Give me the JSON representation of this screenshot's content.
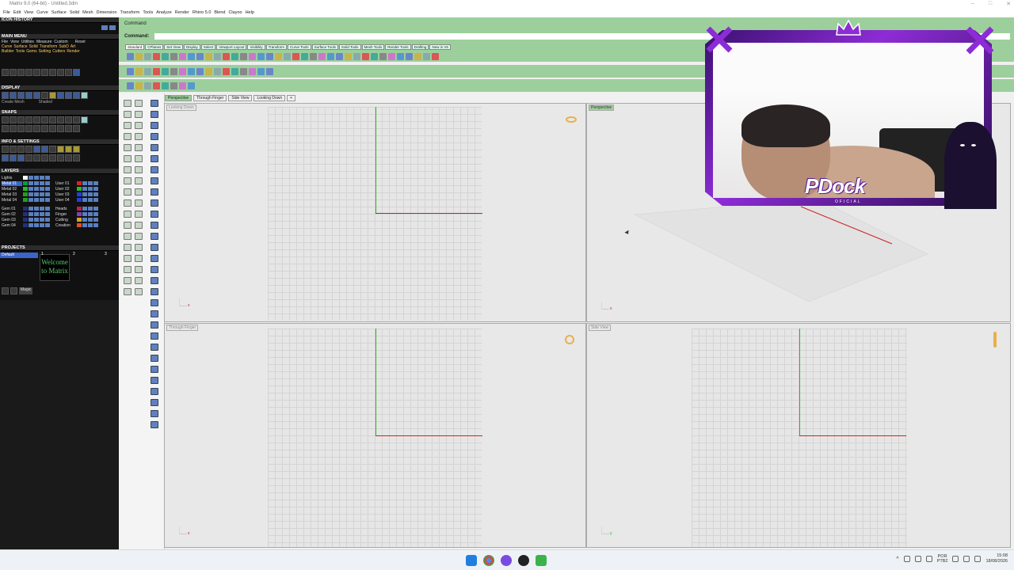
{
  "window": {
    "title": "Matrix 9.0 (64-bit) - Untitled.3dm"
  },
  "menu": [
    "File",
    "Edit",
    "View",
    "Curve",
    "Surface",
    "Solid",
    "Mesh",
    "Dimension",
    "Transform",
    "Tools",
    "Analyze",
    "Render",
    "Rhino 5.0",
    "Blend",
    "Clayoo",
    "Help"
  ],
  "left_panel": {
    "icon_history": "ICON HISTORY",
    "main_menu": "MAIN MENU",
    "main_menu_row1": [
      "File",
      "View",
      "Utilities",
      "Measure",
      "Custom",
      "Reset"
    ],
    "main_menu_row2": [
      "Curve",
      "Surface",
      "Solid",
      "Transform",
      "SubD",
      "Art"
    ],
    "main_menu_row3": [
      "Builder",
      "Tools",
      "Gems",
      "Setting",
      "Cutters",
      "Render"
    ],
    "display": "DISPLAY",
    "display_sub": [
      "Create Mesh",
      "Shaded"
    ],
    "snaps": "SNAPS",
    "info_settings": "INFO & SETTINGS",
    "layers": "LAYERS",
    "layers_list": [
      {
        "left": "Lights",
        "right": "",
        "left_color": "#ffffff",
        "right_color": ""
      },
      {
        "left": "Metal 01",
        "right": "User 01",
        "left_color": "#00a040",
        "right_color": "#e02020",
        "selected": true
      },
      {
        "left": "Metal 02",
        "right": "User 02",
        "left_color": "#20c020",
        "right_color": "#20c020"
      },
      {
        "left": "Metal 03",
        "right": "User 03",
        "left_color": "#20a020",
        "right_color": "#2040e0"
      },
      {
        "left": "Metal 04",
        "right": "User 04",
        "left_color": "#20a020",
        "right_color": "#2040e0"
      },
      {
        "left": "Gem 01",
        "right": "Heads",
        "left_color": "#203080",
        "right_color": "#c02040"
      },
      {
        "left": "Gem 02",
        "right": "Finger",
        "left_color": "#203080",
        "right_color": "#8040c0"
      },
      {
        "left": "Gem 03",
        "right": "Cutting",
        "left_color": "#203080",
        "right_color": "#e0a020"
      },
      {
        "left": "Gem 04",
        "right": "Creation",
        "left_color": "#203080",
        "right_color": "#e05020"
      }
    ],
    "projects": "PROJECTS",
    "project_default": "Default",
    "project_tile_numbers": [
      "1",
      "2",
      "3"
    ],
    "project_tile_text": "Welcome to Matrix",
    "project_btn": "Magic"
  },
  "command": {
    "line1": "Command",
    "line2": "Command:"
  },
  "toolbar_tabs": [
    "Standard",
    "CPlanes",
    "Set View",
    "Display",
    "Select",
    "Viewport Layout",
    "Visibility",
    "Transform",
    "Curve Tools",
    "Surface Tools",
    "Solid Tools",
    "Mesh Tools",
    "Render Tools",
    "Drafting",
    "New in V5"
  ],
  "viewport_tabs": [
    "Perspective",
    "Through Finger",
    "Side View",
    "Looking Down",
    "+"
  ],
  "viewports": {
    "top_left": "Looking Down",
    "top_right": "Perspective",
    "bottom_left": "Through Finger",
    "bottom_right": "Side View"
  },
  "gizmo_labels": {
    "x": "x",
    "y": "y"
  },
  "webcam": {
    "brand": "PDock",
    "tagline": "OFICIAL"
  },
  "taskbar": {
    "lang_top": "POR",
    "lang_bottom": "PTB2",
    "time": "15:08",
    "date": "18/08/2026"
  },
  "colors": {
    "command_green": "#9ccf9c",
    "axis_x": "#cc2222",
    "axis_y": "#33aa33",
    "overlay_purple": "#8d2cd6"
  }
}
